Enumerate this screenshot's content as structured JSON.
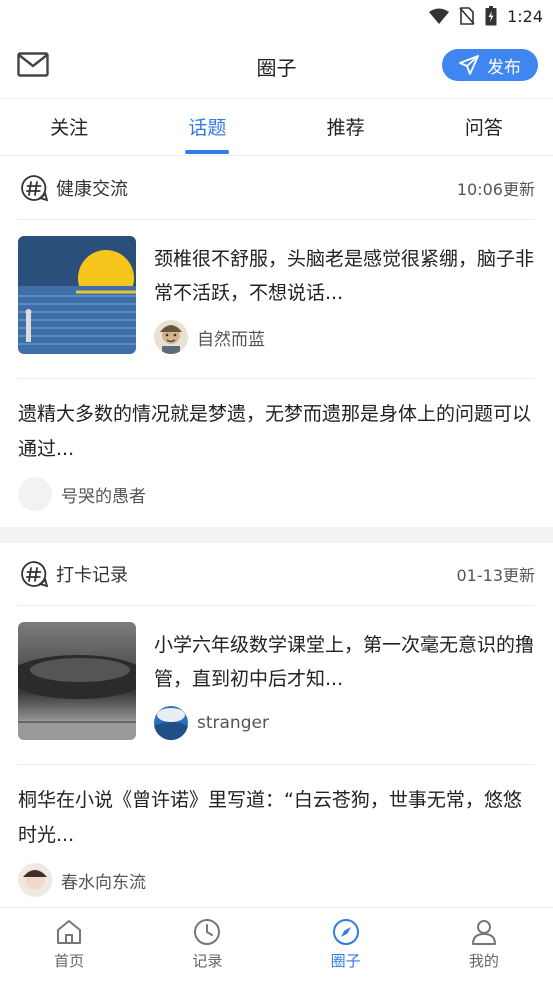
{
  "status": {
    "time": "1:24"
  },
  "appbar": {
    "title": "圈子",
    "publish_label": "发布",
    "mail_icon": "mail-icon",
    "publish_icon": "send-icon"
  },
  "tabs": [
    {
      "label": "关注",
      "active": false
    },
    {
      "label": "话题",
      "active": true
    },
    {
      "label": "推荐",
      "active": false
    },
    {
      "label": "问答",
      "active": false
    }
  ],
  "cards": [
    {
      "topic": "健康交流",
      "updated": "10:06更新",
      "posts": [
        {
          "text": "颈椎很不舒服，头脑老是感觉很紧绷，脑子非常不活跃，不想说话...",
          "author": "自然而蓝"
        },
        {
          "text": "遗精大多数的情况就是梦遗，无梦而遗那是身体上的问题可以通过...",
          "author": "号哭的愚者"
        }
      ]
    },
    {
      "topic": "打卡记录",
      "updated": "01-13更新",
      "posts": [
        {
          "text": "小学六年级数学课堂上，第一次毫无意识的撸管，直到初中后才知...",
          "author": "stranger"
        },
        {
          "text": "桐华在小说《曾许诺》里写道：“白云苍狗，世事无常，悠悠时光...",
          "author": "春水向东流"
        }
      ]
    }
  ],
  "bottom_nav": [
    {
      "label": "首页",
      "icon": "home-icon",
      "active": false
    },
    {
      "label": "记录",
      "icon": "clock-icon",
      "active": false
    },
    {
      "label": "圈子",
      "icon": "compass-icon",
      "active": true
    },
    {
      "label": "我的",
      "icon": "user-icon",
      "active": false
    }
  ],
  "colors": {
    "accent": "#2f7be8",
    "publish_bg": "#3f86f0",
    "divider": "#f2f3f5"
  }
}
